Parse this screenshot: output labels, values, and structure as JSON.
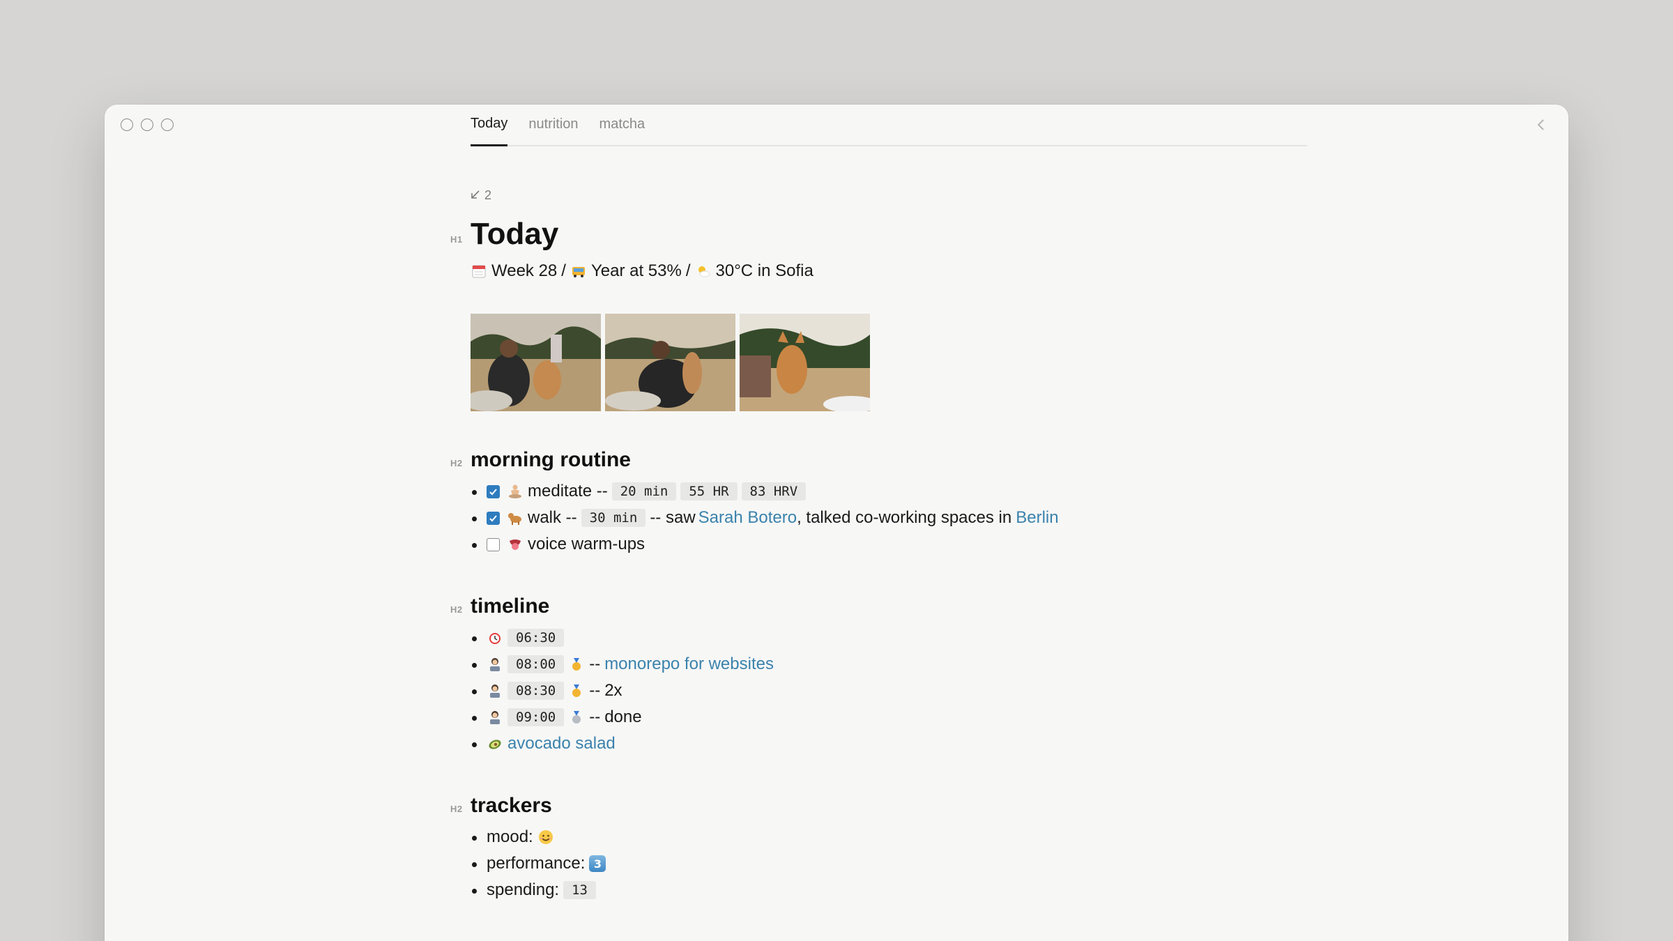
{
  "tabs": [
    {
      "label": "Today",
      "active": true
    },
    {
      "label": "nutrition",
      "active": false
    },
    {
      "label": "matcha",
      "active": false
    }
  ],
  "backlinks": {
    "icon": "arrow-down-left-icon",
    "count": "2"
  },
  "page": {
    "heading_marker": "H1",
    "title": "Today",
    "subtitle": {
      "week": "Week 28",
      "sep1": "/",
      "year": "Year at 53%",
      "sep2": "/",
      "weather": "30°C in Sofia"
    }
  },
  "photos": [
    {
      "name": "photo-dog-people-1"
    },
    {
      "name": "photo-dog-people-2"
    },
    {
      "name": "photo-shiba-dog"
    }
  ],
  "sections": {
    "morning": {
      "marker": "H2",
      "title": "morning routine",
      "items": [
        {
          "checked": true,
          "label": "meditate --",
          "chips": [
            "20 min",
            "55 HR",
            "83 HRV"
          ]
        },
        {
          "checked": true,
          "label": "walk --",
          "chip": "30 min",
          "mid": "-- saw",
          "link1": "Sarah Botero",
          "mid2": ", talked co-working spaces in",
          "link2": "Berlin"
        },
        {
          "checked": false,
          "label": "voice warm-ups"
        }
      ]
    },
    "timeline": {
      "marker": "H2",
      "title": "timeline",
      "items": [
        {
          "time": "06:30"
        },
        {
          "time": "08:00",
          "sep": "--",
          "link": "monorepo for websites"
        },
        {
          "time": "08:30",
          "sep": "--",
          "text": "2x"
        },
        {
          "time": "09:00",
          "sep": "--",
          "text": "done"
        },
        {
          "link": "avocado salad"
        }
      ]
    },
    "trackers": {
      "marker": "H2",
      "title": "trackers",
      "items": [
        {
          "label": "mood:"
        },
        {
          "label": "performance:",
          "badge": "3"
        },
        {
          "label": "spending:",
          "chip": "13"
        }
      ]
    }
  },
  "colors": {
    "link": "#3b82ac",
    "checkbox": "#2e7cbf",
    "code_bg": "#e7e7e5"
  }
}
